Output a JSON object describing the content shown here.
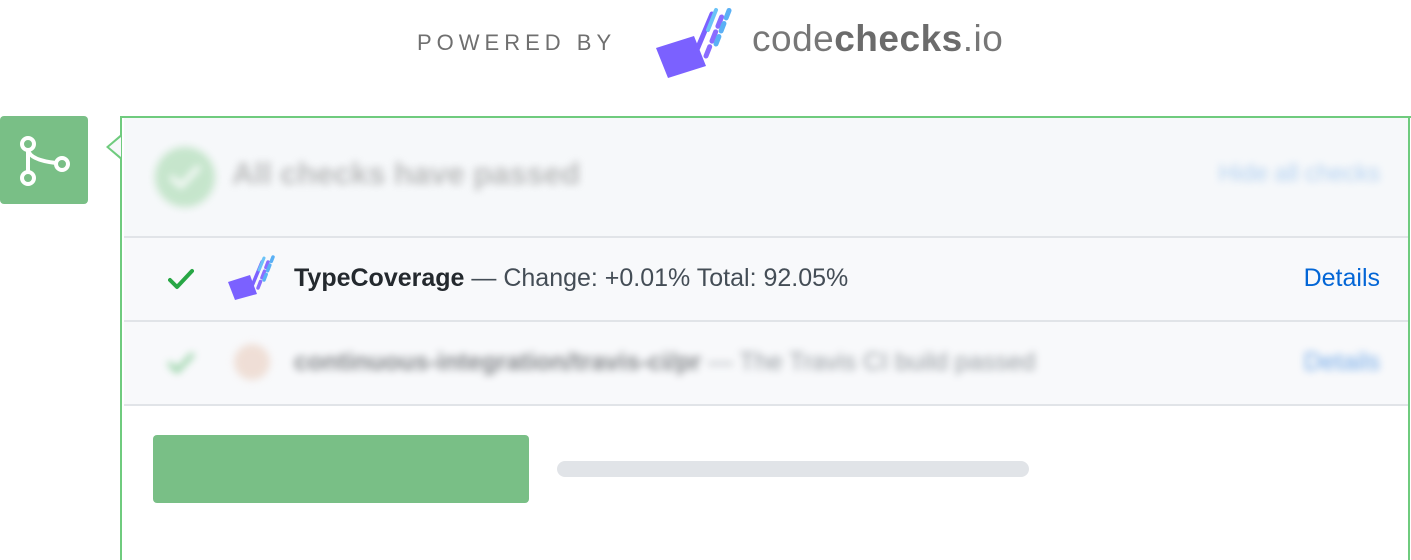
{
  "header": {
    "powered_by": "POWERED BY",
    "brand_light": "code",
    "brand_bold": "checks",
    "brand_suffix": ".io",
    "brand_color": "#7b61ff"
  },
  "summary": {
    "title": "All checks have passed",
    "toggle_link": "Hide all checks"
  },
  "checks": [
    {
      "name": "TypeCoverage",
      "description": "— Change: +0.01% Total: 92.05%",
      "details": "Details",
      "status": "success",
      "icon": "codechecks-logo-icon"
    },
    {
      "name": "continuous-integration/travis-ci/pr",
      "description": "— The Travis CI build passed",
      "details": "Details",
      "status": "success",
      "icon": "travis-ci-avatar"
    }
  ],
  "colors": {
    "accent_green": "#6fcb7e",
    "badge_green": "#79bf86",
    "link_blue": "#0366d6",
    "check_green": "#28a745"
  }
}
